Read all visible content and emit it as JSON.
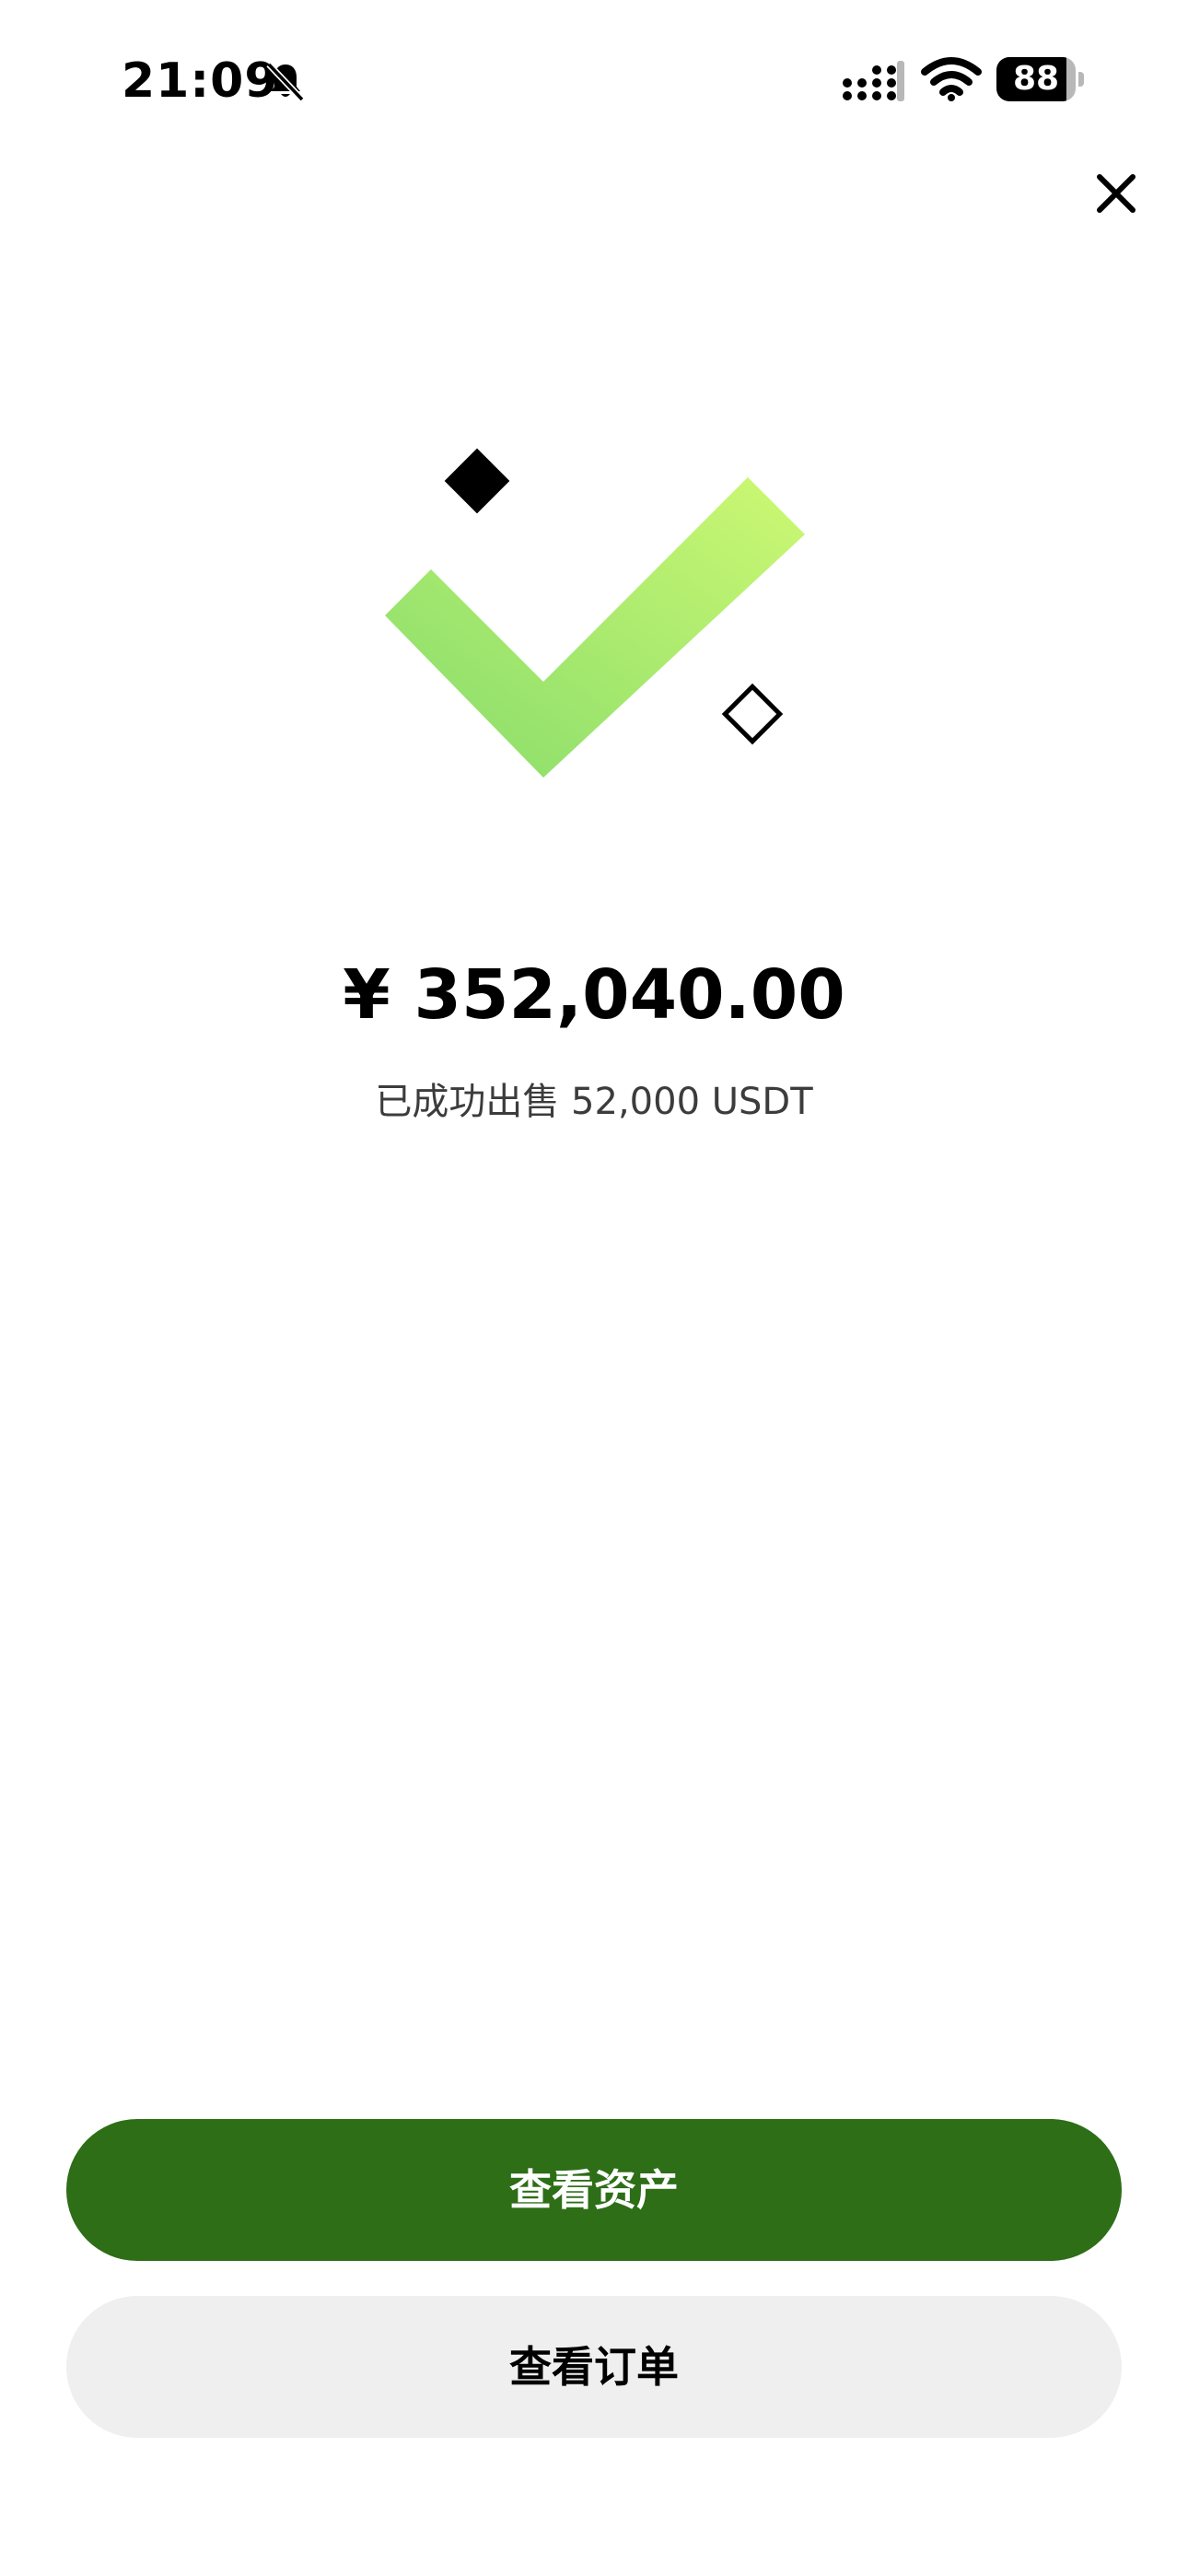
{
  "status_bar": {
    "time": "21:09",
    "battery_level": "88",
    "battery_fraction": 0.88,
    "icons": [
      "bell-slash-icon",
      "cellular-signal-icon",
      "wifi-icon",
      "battery-icon"
    ]
  },
  "header": {
    "close_icon": "close-icon"
  },
  "result": {
    "icon": "success-check-icon",
    "amount": "¥ 352,040.00",
    "message": "已成功出售 52,000 USDT"
  },
  "actions": {
    "view_assets_label": "查看资产",
    "view_orders_label": "查看订单"
  },
  "colors": {
    "primary_button": "#2d6e17",
    "secondary_button": "#efefef",
    "check_gradient_start": "#86dc6b",
    "check_gradient_end": "#cdf873"
  }
}
